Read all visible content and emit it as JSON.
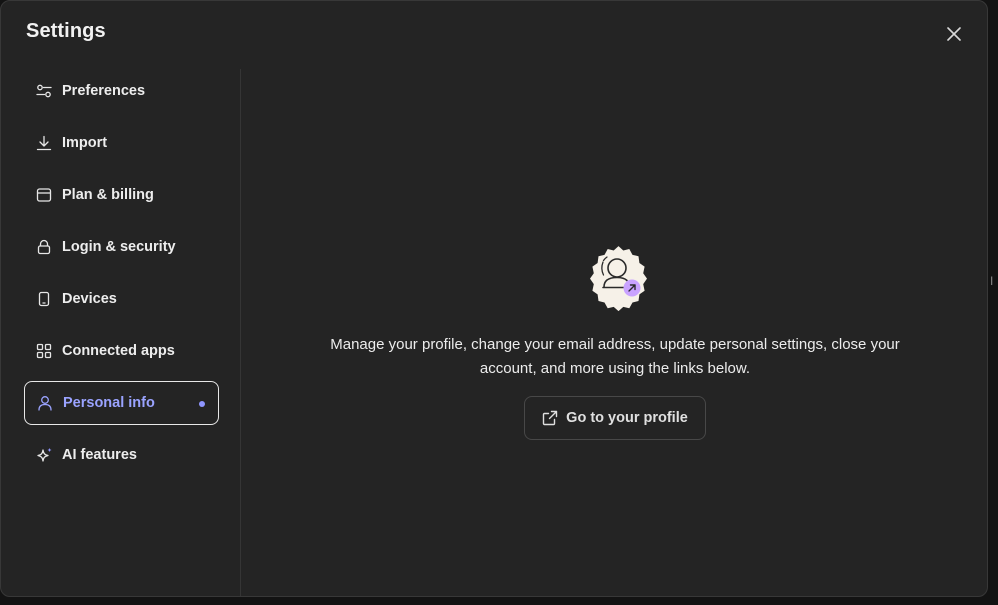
{
  "dialog": {
    "title": "Settings"
  },
  "sidebar": {
    "items": [
      {
        "id": "preferences",
        "label": "Preferences",
        "icon": "sliders-icon"
      },
      {
        "id": "import",
        "label": "Import",
        "icon": "download-icon"
      },
      {
        "id": "plan-billing",
        "label": "Plan & billing",
        "icon": "archive-box-icon"
      },
      {
        "id": "login-security",
        "label": "Login & security",
        "icon": "lock-icon"
      },
      {
        "id": "devices",
        "label": "Devices",
        "icon": "phone-icon"
      },
      {
        "id": "connected-apps",
        "label": "Connected apps",
        "icon": "grid-icon"
      },
      {
        "id": "personal-info",
        "label": "Personal info",
        "icon": "person-icon",
        "active": true
      },
      {
        "id": "ai-features",
        "label": "AI features",
        "icon": "sparkle-icon"
      }
    ]
  },
  "main": {
    "description": "Manage your profile, change your email address, update personal settings, close your account, and more using the links below.",
    "profile_button": "Go to your profile"
  },
  "background": {
    "edge_text": "I"
  },
  "colors": {
    "accent": "#9aa3ff",
    "badge_bg": "#f6f1e8",
    "badge_arrow_bg": "#c9a2ff",
    "modal_bg": "#242424"
  }
}
